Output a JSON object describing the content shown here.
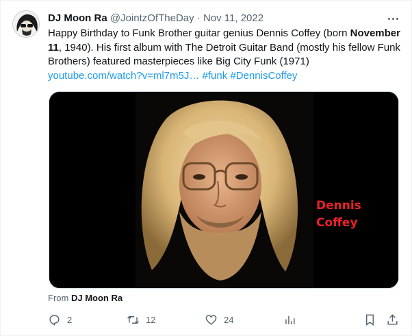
{
  "tweet": {
    "author_name": "DJ Moon Ra",
    "author_handle": "@JointzOfTheDay",
    "separator": "·",
    "date": "Nov 11, 2022",
    "text_part1": "Happy Birthday to Funk Brother guitar genius Dennis Coffey (born ",
    "text_bold": "November 11",
    "text_part2": ", 1940). His first album with The Detroit Guitar Band (mostly his fellow Funk Brothers) featured masterpieces like Big City Funk (1971)",
    "link_url": "youtube.com/watch?v=ml7m5J…",
    "hashtag1": "#funk",
    "hashtag2": "#DennisCoffey",
    "media_caption_line1": "Dennis",
    "media_caption_line2": "Coffey",
    "from_prefix": "From",
    "from_name": "DJ Moon Ra"
  },
  "actions": {
    "reply_icon": "reply-icon",
    "reply_count": "2",
    "retweet_icon": "retweet-icon",
    "retweet_count": "12",
    "like_icon": "heart-icon",
    "like_count": "24",
    "views_icon": "analytics-icon",
    "bookmark_icon": "bookmark-icon",
    "share_icon": "share-icon"
  },
  "colors": {
    "link": "#1d9bf0",
    "secondary_text": "#536471",
    "primary_text": "#0f1419",
    "caption_red": "#e8232a",
    "media_bg": "#000000"
  }
}
